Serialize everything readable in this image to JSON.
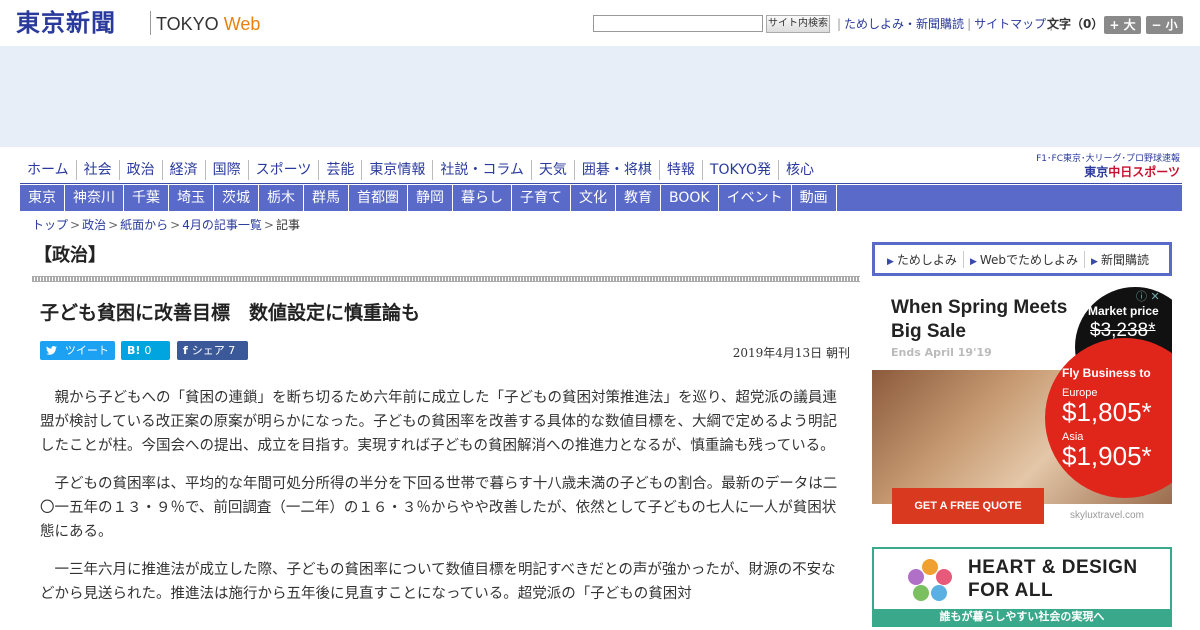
{
  "header": {
    "logo": "東京新聞",
    "logo_sub_a": "TOKYO ",
    "logo_sub_b": "Web",
    "search_button": "サイト内検索",
    "links": [
      "ためしよみ・新聞購読",
      "サイトマップ"
    ],
    "font_size_label": "文字（0）",
    "font_increase": "+ 大",
    "font_decrease": "− 小"
  },
  "main_nav": [
    "ホーム",
    "社会",
    "政治",
    "経済",
    "国際",
    "スポーツ",
    "芸能",
    "東京情報",
    "社説・コラム",
    "天気",
    "囲碁・将棋",
    "特報",
    "TOKYO発",
    "核心"
  ],
  "sponsor": {
    "top": "F1･FC東京･大リーグ･プロ野球速報",
    "logo_a": "東京",
    "logo_b": "中日スポーツ"
  },
  "region_nav": [
    "東京",
    "神奈川",
    "千葉",
    "埼玉",
    "茨城",
    "栃木",
    "群馬",
    "首都圏",
    "静岡",
    "暮らし",
    "子育て",
    "文化",
    "教育",
    "BOOK",
    "イベント",
    "動画"
  ],
  "breadcrumb": [
    "トップ",
    "政治",
    "紙面から",
    "4月の記事一覧",
    "記事"
  ],
  "section_title": "【政治】",
  "article": {
    "title": "子ども貧困に改善目標　数値設定に慎重論も",
    "date": "2019年4月13日 朝刊",
    "share": {
      "tweet": "ツイート",
      "hatena_icon": "B!",
      "hatena_count": "0",
      "fb_icon": "f",
      "fb_label": "シェア",
      "fb_count": "7"
    },
    "paragraphs": [
      "親から子どもへの「貧困の連鎖」を断ち切るため六年前に成立した「子どもの貧困対策推進法」を巡り、超党派の議員連盟が検討している改正案の原案が明らかになった。子どもの貧困率を改善する具体的な数値目標を、大綱で定めるよう明記したことが柱。今国会への提出、成立を目指す。実現すれば子どもの貧困解消への推進力となるが、慎重論も残っている。",
      "子どもの貧困率は、平均的な年間可処分所得の半分を下回る世帯で暮らす十八歳未満の子どもの割合。最新のデータは二〇一五年の１３・９％で、前回調査（一二年）の１６・３％からやや改善したが、依然として子どもの七人に一人が貧困状態にある。",
      "一三年六月に推進法が成立した際、子どもの貧困率について数値目標を明記すべきだとの声が強かったが、財源の不安などから見送られた。推進法は施行から五年後に見直すことになっている。超党派の「子どもの貧困対"
    ]
  },
  "promo_links": [
    "ためしよみ",
    "Webでためしよみ",
    "新聞購読"
  ],
  "ad1": {
    "headline": "When Spring Meets Big Sale",
    "ends": "Ends April 19'19",
    "adchoice": "ⓘ ✕",
    "market_label": "Market price",
    "market_price": "$3,238*",
    "fly": "Fly Business to",
    "europe_label": "Europe",
    "europe_price": "$1,805*",
    "asia_label": "Asia",
    "asia_price": "$1,905*",
    "cta": "GET A FREE QUOTE",
    "domain": "skyluxtravel.com"
  },
  "ad2": {
    "title_top": "HEART & DESIGN",
    "title_bottom": "FOR ALL",
    "bar": "誰もが暮らしやすい社会の実現へ"
  }
}
